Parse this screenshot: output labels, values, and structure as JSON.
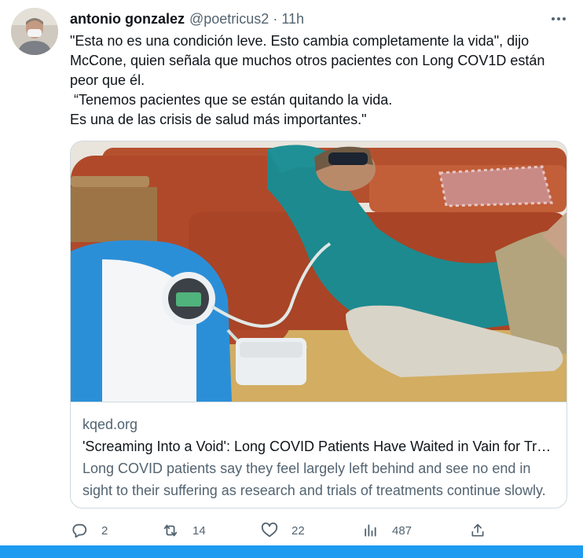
{
  "tweet": {
    "author": {
      "display_name": "antonio gonzalez",
      "handle": "@poetricus2",
      "separator": "·",
      "time": "11h"
    },
    "text_lines": [
      "\"Esta no es una condición leve. Esto cambia completamente la vida\", dijo McCone, quien señala que muchos otros pacientes con Long COV1D están peor que él.",
      " “Tenemos pacientes que se están quitando la vida.",
      "Es una de las crisis de salud más importantes.\""
    ]
  },
  "card": {
    "domain": "kqed.org",
    "title": "'Screaming Into a Void': Long COVID Patients Have Waited in Vain for Treatment",
    "description": "Long COVID patients say they feel largely left behind and see no end in sight to their suffering as research and trials of treatments continue slowly."
  },
  "actions": {
    "reply": {
      "icon": "reply-icon",
      "count": "2"
    },
    "retweet": {
      "icon": "retweet-icon",
      "count": "14"
    },
    "like": {
      "icon": "heart-icon",
      "count": "22"
    },
    "views": {
      "icon": "views-icon",
      "count": "487"
    },
    "share": {
      "icon": "share-icon"
    }
  },
  "colors": {
    "text": "#0f1419",
    "secondary": "#536471",
    "border": "#cfd9de",
    "accent": "#1d9bf0"
  }
}
